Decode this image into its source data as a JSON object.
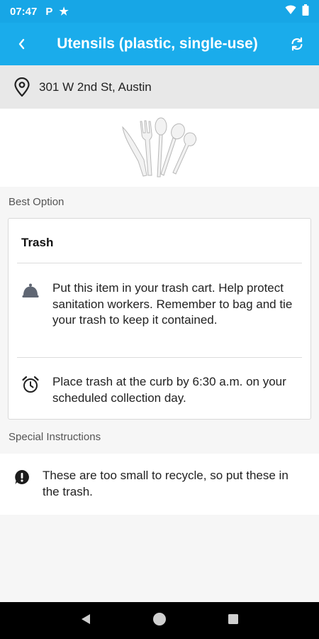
{
  "status_bar": {
    "time": "07:47",
    "icons": [
      "p-icon",
      "star-icon",
      "wifi-icon",
      "battery-icon"
    ]
  },
  "app_bar": {
    "title": "Utensils (plastic, single-use)",
    "back_icon": "back-chevron-icon",
    "refresh_icon": "refresh-icon"
  },
  "location": {
    "icon": "location-pin-icon",
    "address": "301 W 2nd St, Austin"
  },
  "item_image": "plastic-utensils-image",
  "best_option": {
    "section_label": "Best Option",
    "title": "Trash",
    "instructions": [
      {
        "icon": "trash-bell-icon",
        "text": "Put this item in your trash cart. Help protect sanitation workers. Remember to bag and tie your trash to keep it contained."
      },
      {
        "icon": "alarm-clock-icon",
        "text": "Place trash at the curb by 6:30 a.m. on your scheduled collection day."
      }
    ]
  },
  "special_instructions": {
    "section_label": "Special Instructions",
    "icon": "alert-icon",
    "text": "These are too small to recycle, so put these in the trash."
  },
  "nav_bar": {
    "buttons": [
      "back-triangle-icon",
      "home-circle-icon",
      "recents-square-icon"
    ]
  },
  "colors": {
    "status_bar": "#17a6e6",
    "app_bar": "#1aaceb",
    "address_bar": "#e8e8e8",
    "background": "#f6f6f6"
  }
}
